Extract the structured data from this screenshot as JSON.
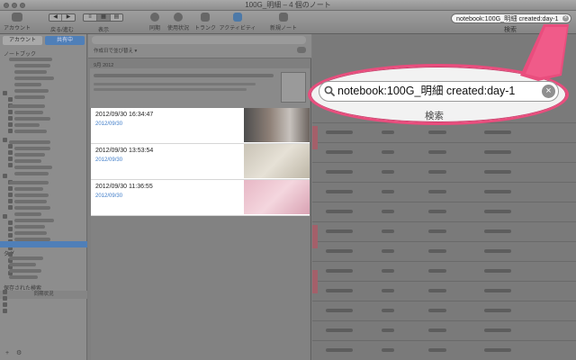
{
  "window": {
    "title": "100G_明細 – 4 個のノート"
  },
  "toolbar": {
    "account": "アカウント",
    "back_forward": "戻る/進む",
    "view": "表示",
    "sync": "同期",
    "usage": "使用状況",
    "trunk": "トランク",
    "activity": "アクティビティ",
    "new_note": "新規ノート",
    "search_label": "検索",
    "search_query": "notebook:100G_明細 created:day-1"
  },
  "sidebar": {
    "tabs": [
      "アカウント",
      "共有中"
    ],
    "notebooks_header": "ノートブック",
    "tags_header": "タグ",
    "saved_searches_header": "保存された検索",
    "sync_status": "同期状況"
  },
  "note_list": {
    "sort": "作成日で並び替え ▾",
    "section": "9月 2012",
    "notes": [
      {
        "datetime": "2012/09/30 16:34:47",
        "date": "2012/09/30"
      },
      {
        "datetime": "2012/09/30 13:53:54",
        "date": "2012/09/30"
      },
      {
        "datetime": "2012/09/30 11:36:55",
        "date": "2012/09/30"
      }
    ]
  },
  "callout": {
    "search_query": "notebook:100G_明細 created:day-1",
    "search_label": "検索"
  },
  "colors": {
    "callout_border": "#e94d7d",
    "link_date": "#3d7bc8"
  }
}
